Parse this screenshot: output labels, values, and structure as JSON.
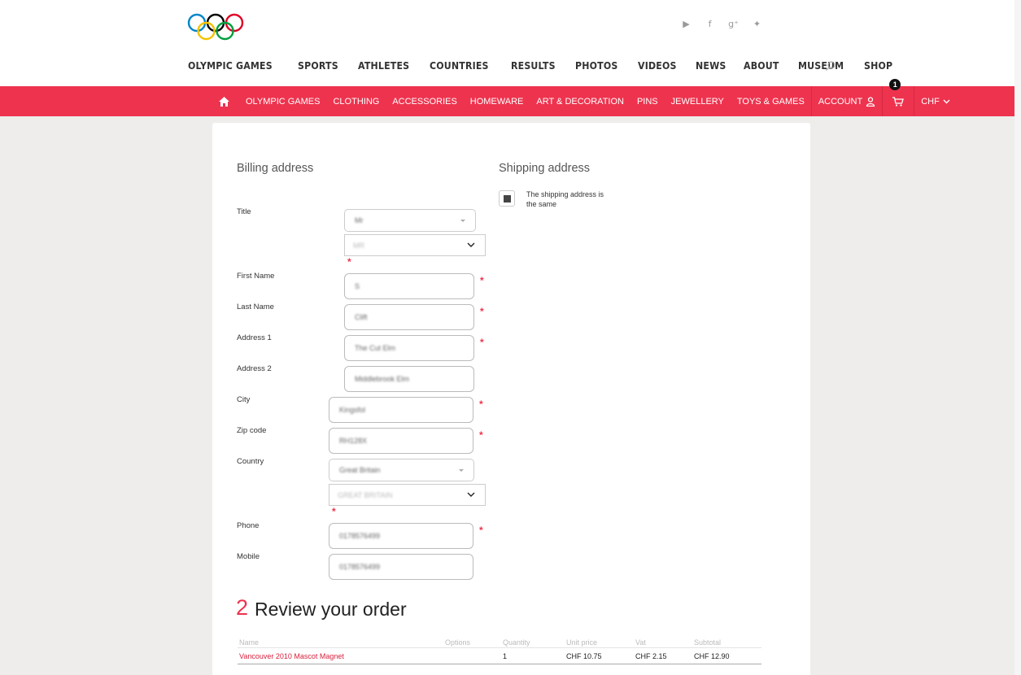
{
  "header": {
    "social_icons": [
      "youtube-icon",
      "facebook-icon",
      "googleplus-icon",
      "twitter-icon"
    ],
    "social_glyphs": [
      "▶",
      "f",
      "g⁺",
      "✦"
    ],
    "nav": [
      "OLYMPIC GAMES",
      "SPORTS",
      "ATHLETES",
      "COUNTRIES",
      "RESULTS",
      "PHOTOS",
      "VIDEOS",
      "NEWS",
      "ABOUT",
      "MUSEUM",
      "SHOP"
    ],
    "ring_colors": [
      "#0085c7",
      "#f4c300",
      "#000000",
      "#009f3d",
      "#df0024"
    ]
  },
  "shopbar": {
    "color": "#ee334e",
    "items": [
      "OLYMPIC GAMES",
      "CLOTHING",
      "ACCESSORIES",
      "HOMEWARE",
      "ART & DECORATION",
      "PINS",
      "JEWELLERY",
      "TOYS & GAMES"
    ],
    "account": "ACCOUNT",
    "cart_count": "1",
    "currency": "CHF"
  },
  "billing": {
    "heading": "Billing address",
    "labels": {
      "title": "Title",
      "first_name": "First Name",
      "last_name": "Last Name",
      "address1": "Address 1",
      "address2": "Address 2",
      "city": "City",
      "zip": "Zip code",
      "country": "Country",
      "phone": "Phone",
      "mobile": "Mobile"
    },
    "values": {
      "title_select": "Mr",
      "title_dropdown": "MR",
      "first_name": "S",
      "last_name": "Clift",
      "address1": "The Cut Elm",
      "address2": "Middlebrook Elm",
      "city": "Kingsfol",
      "zip": "RH128X",
      "country_select": "Great Britain",
      "country_dropdown": "GREAT BRITAIN",
      "phone": "0178576499",
      "mobile": "0178576499"
    },
    "required_mark": "*"
  },
  "shipping": {
    "heading": "Shipping address",
    "same_label": "The shipping address is the same",
    "same_checked": true
  },
  "review": {
    "step": "2",
    "title": "Review your order",
    "columns": [
      "Name",
      "Options",
      "Quantity",
      "Unit price",
      "Vat",
      "Subtotal"
    ],
    "rows": [
      {
        "name": "Vancouver 2010 Mascot Magnet",
        "options": "",
        "quantity": "1",
        "unit_price": "CHF 10.75",
        "vat": "CHF 2.15",
        "subtotal": "CHF 12.90"
      }
    ]
  }
}
